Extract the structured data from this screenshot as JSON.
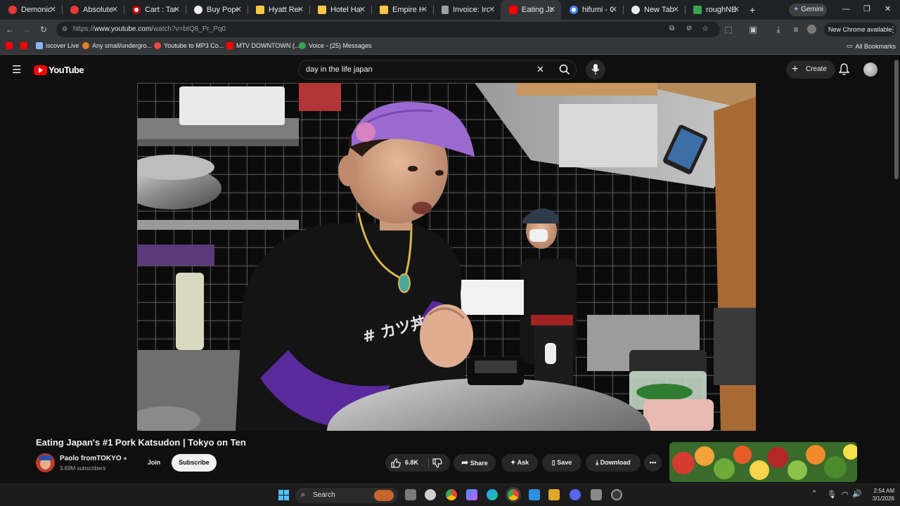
{
  "browser": {
    "tabs": [
      {
        "label": "Demonic A",
        "color": "#e53935"
      },
      {
        "label": "Absolute D",
        "color": "#e53935"
      },
      {
        "label": "Cart : Targe",
        "color": "#cc0000"
      },
      {
        "label": "Buy Popov",
        "color": "#eeeeee"
      },
      {
        "label": "Hyatt Rege",
        "color": "#f6c744"
      },
      {
        "label": "Hotel Hayd",
        "color": "#f6c744"
      },
      {
        "label": "Empire Hot",
        "color": "#f6c744"
      },
      {
        "label": "Invoice: Iro",
        "color": "#9aa0a6"
      },
      {
        "label": "Eating Japa",
        "color": "#ff0000"
      },
      {
        "label": "hifumi - Go",
        "color": "#8ab4f8"
      },
      {
        "label": "New Tab",
        "color": "#8ab4f8"
      },
      {
        "label": "roughNE",
        "color": "#34a853"
      }
    ],
    "gemini_label": "Gemini",
    "url_prefix": "https://",
    "url_host": "www.youtube.com",
    "url_path": "/watch?v=bIQ8_Pr_Pq0",
    "new_chrome_label": "New Chrome available",
    "bookmarks": [
      {
        "label": "iscover Live",
        "color": "#8ab4f8"
      },
      {
        "label": "Any small/undergro...",
        "color": "#e67e22"
      },
      {
        "label": "Youtube to MP3 Co...",
        "color": "#e74c3c"
      },
      {
        "label": "MTV DOWNTOWN (...",
        "color": "#ff0000"
      },
      {
        "label": "Voice - (25) Messages",
        "color": "#34a853"
      }
    ],
    "all_bookmarks_label": "All Bookmarks"
  },
  "youtube": {
    "logo_text": "YouTube",
    "search_query": "day in the life japan",
    "create_label": "Create",
    "video": {
      "title": "Eating Japan's #1 Pork Katsudon | Tokyo on Ten",
      "channel": "Paolo fromTOKYO",
      "subscribers": "3.69M subscribers",
      "join_label": "Join",
      "subscribe_label": "Subscribe",
      "likes": "6.8K",
      "share_label": "Share",
      "ask_label": "Ask",
      "save_label": "Save",
      "download_label": "Download",
      "shirt_text": "# カツ丼"
    }
  },
  "taskbar": {
    "search_label": "Search",
    "time": "2:54 AM",
    "date": "3/1/2026"
  }
}
